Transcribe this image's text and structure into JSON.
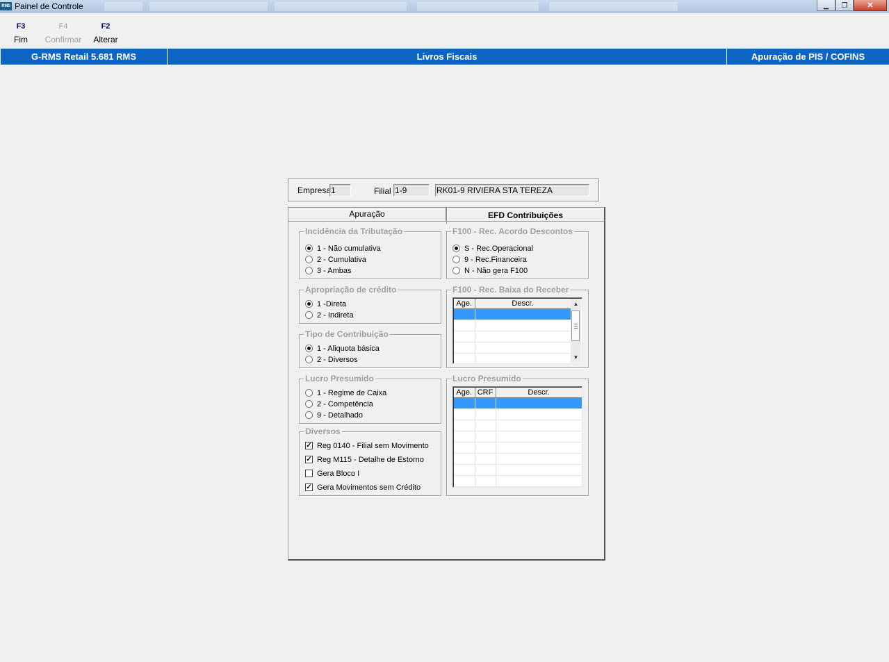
{
  "window": {
    "title": "Painel de Controle",
    "logo_text": "RMS",
    "controls": {
      "minimize": "▁",
      "restore": "❐",
      "close": "✕"
    }
  },
  "toolbar": {
    "buttons": [
      {
        "key": "F3",
        "label": "Fim",
        "enabled": true
      },
      {
        "key": "F4",
        "label": "Confirmar",
        "enabled": false
      },
      {
        "key": "F2",
        "label": "Alterar",
        "enabled": true
      }
    ]
  },
  "header": {
    "system": "G-RMS Retail 5.681 RMS",
    "module": "Livros Fiscais",
    "screen": "Apuração de PIS / COFINS"
  },
  "filter": {
    "empresa_label": "Empresa",
    "empresa_value": "1",
    "filial_label": "Filial",
    "filial_value": "1-9",
    "filial_name": "RK01-9 RIVIERA STA TEREZA"
  },
  "tabs": {
    "apuracao": "Apuração",
    "efd": "EFD Contribuições",
    "active": "efd"
  },
  "groups": {
    "incidencia": {
      "title": "Incidência da Tributação",
      "options": [
        "1 - Não cumulativa",
        "2 - Cumulativa",
        "3 - Ambas"
      ],
      "selected": 0
    },
    "apropriacao": {
      "title": "Apropriação de crédito",
      "options": [
        "1 -Direta",
        "2 - Indireta"
      ],
      "selected": 0
    },
    "tipo": {
      "title": "Tipo de Contribuição",
      "options": [
        "1 - Aliquota básica",
        "2 - Diversos"
      ],
      "selected": 0
    },
    "lucro_left": {
      "title": "Lucro Presumido",
      "options": [
        "1 - Regime de Caixa",
        "2 - Competência",
        "9 - Detalhado"
      ],
      "selected": null
    },
    "diversos": {
      "title": "Diversos",
      "checks": [
        {
          "label": "Reg 0140 - Filial sem Movimento",
          "checked": true
        },
        {
          "label": "Reg M115 - Detalhe de Estorno",
          "checked": true
        },
        {
          "label": "Gera Bloco I",
          "checked": false
        },
        {
          "label": "Gera Movimentos sem Crédito",
          "checked": true
        }
      ]
    },
    "f100_acordo": {
      "title": "F100 - Rec. Acordo Descontos",
      "options": [
        "S - Rec.Operacional",
        "9 - Rec.Financeira",
        "N - Não gera F100"
      ],
      "selected": 0
    },
    "f100_baixa": {
      "title": "F100 - Rec. Baixa do Receber",
      "columns": [
        "Age.",
        "Descr."
      ]
    },
    "lucro_right": {
      "title": "Lucro Presumido",
      "columns": [
        "Age.",
        "CRF",
        "Descr."
      ]
    }
  }
}
